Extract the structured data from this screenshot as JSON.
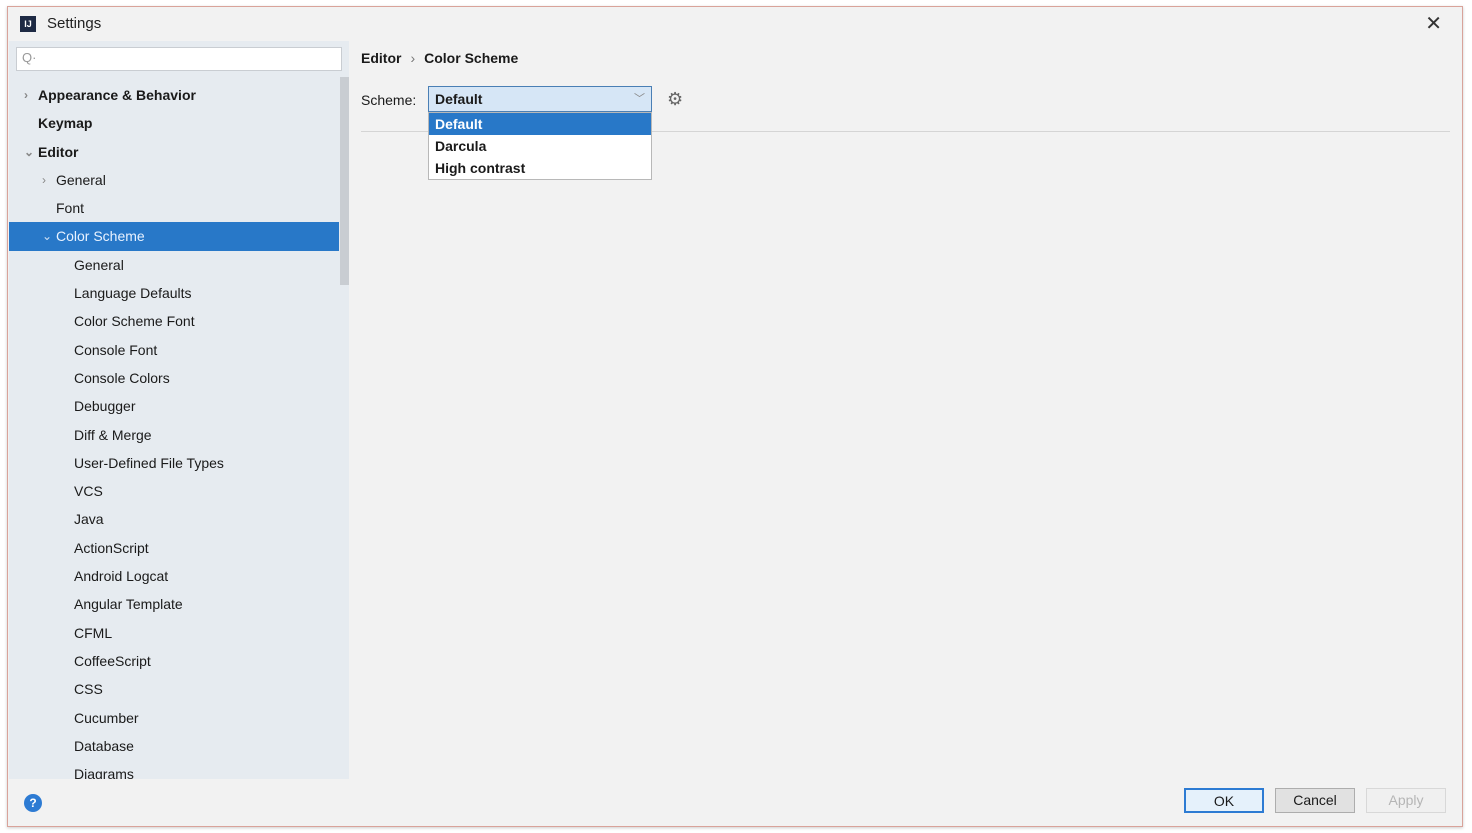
{
  "window": {
    "title": "Settings",
    "app_icon": "IJ"
  },
  "search": {
    "placeholder": "Q·"
  },
  "tree": [
    {
      "label": "Appearance & Behavior",
      "level": 0,
      "bold": true,
      "arrow": "›"
    },
    {
      "label": "Keymap",
      "level": 0,
      "bold": true,
      "arrow": ""
    },
    {
      "label": "Editor",
      "level": 0,
      "bold": true,
      "arrow": "⌄"
    },
    {
      "label": "General",
      "level": 1,
      "arrow": "›"
    },
    {
      "label": "Font",
      "level": 1,
      "arrow": ""
    },
    {
      "label": "Color Scheme",
      "level": 1,
      "arrow": "⌄",
      "selected": true
    },
    {
      "label": "General",
      "level": 2
    },
    {
      "label": "Language Defaults",
      "level": 2
    },
    {
      "label": "Color Scheme Font",
      "level": 2
    },
    {
      "label": "Console Font",
      "level": 2
    },
    {
      "label": "Console Colors",
      "level": 2
    },
    {
      "label": "Debugger",
      "level": 2
    },
    {
      "label": "Diff & Merge",
      "level": 2
    },
    {
      "label": "User-Defined File Types",
      "level": 2
    },
    {
      "label": "VCS",
      "level": 2
    },
    {
      "label": "Java",
      "level": 2
    },
    {
      "label": "ActionScript",
      "level": 2
    },
    {
      "label": "Android Logcat",
      "level": 2
    },
    {
      "label": "Angular Template",
      "level": 2
    },
    {
      "label": "CFML",
      "level": 2
    },
    {
      "label": "CoffeeScript",
      "level": 2
    },
    {
      "label": "CSS",
      "level": 2
    },
    {
      "label": "Cucumber",
      "level": 2
    },
    {
      "label": "Database",
      "level": 2
    },
    {
      "label": "Diagrams",
      "level": 2
    }
  ],
  "breadcrumb": {
    "parent": "Editor",
    "sep": "›",
    "current": "Color Scheme"
  },
  "scheme": {
    "label": "Scheme:",
    "value": "Default",
    "options": [
      "Default",
      "Darcula",
      "High contrast"
    ]
  },
  "footer": {
    "help": "?",
    "ok": "OK",
    "cancel": "Cancel",
    "apply": "Apply"
  }
}
